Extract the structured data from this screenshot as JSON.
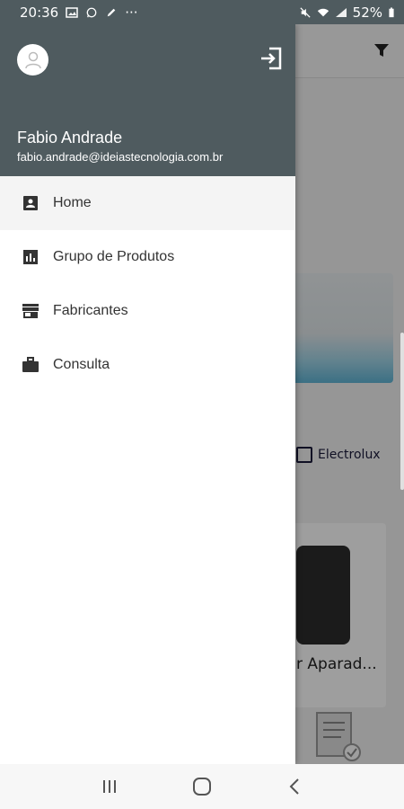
{
  "status_bar": {
    "time": "20:36",
    "more": "···",
    "battery": "52%"
  },
  "background_app": {
    "brand_text": "Electrolux",
    "card_label": "r Aparad..."
  },
  "drawer": {
    "user": {
      "name": "Fabio Andrade",
      "email": "fabio.andrade@ideiastecnologia.com.br"
    },
    "menu": [
      {
        "label": "Home",
        "icon": "contact-card-icon"
      },
      {
        "label": "Grupo de Produtos",
        "icon": "bar-chart-icon"
      },
      {
        "label": "Fabricantes",
        "icon": "store-icon"
      },
      {
        "label": "Consulta",
        "icon": "briefcase-icon"
      }
    ]
  },
  "colors": {
    "header": "#4f5b5f",
    "scrim": "rgba(0,0,0,0.38)"
  }
}
